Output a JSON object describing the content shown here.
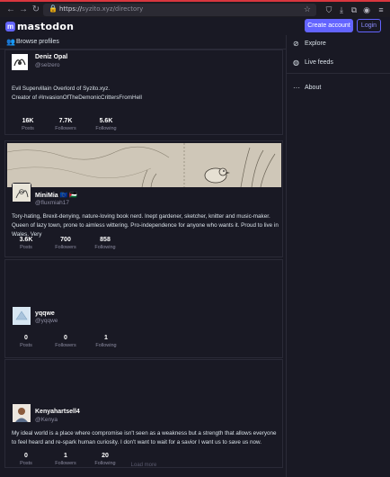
{
  "browser": {
    "url_domain": "sy",
    "url_rest": "zito.xyz",
    "url_path": "/directory",
    "back_icon": "arrow-left-icon",
    "forward_icon": "arrow-right-icon",
    "reload_icon": "reload-icon"
  },
  "header": {
    "logo_text": "mastodon",
    "create_account_label": "Create account",
    "login_label": "Login"
  },
  "main": {
    "title": "Browse profiles",
    "load_more_label": "Load more",
    "profiles": [
      {
        "name": "Deniz Opal",
        "handle": "@selzero",
        "bio": "Evil Supervillain Overlord of Syzito.xyz.\nCreator of #InvasionOfTheDemonicCrittersFromHell",
        "stats": [
          {
            "value": "16K",
            "label": "Posts"
          },
          {
            "value": "7.7K",
            "label": "Followers"
          },
          {
            "value": "5.6K",
            "label": "Following"
          }
        ]
      },
      {
        "name": "MiniMia 🇪🇺 🇵🇸",
        "handle": "@fluxmiah17",
        "bio": "Tory-hating, Brexit-denying, nature-loving book nerd. Inept gardener, sketcher, knitter and music-maker. Queen of lazy town, prone to aimless wittering. Pro-independence for anyone who wants it. Proud to live in Wales. Very",
        "stats": [
          {
            "value": "3.6K",
            "label": "Posts"
          },
          {
            "value": "700",
            "label": "Followers"
          },
          {
            "value": "858",
            "label": "Following"
          }
        ]
      },
      {
        "name": "yqqwe",
        "handle": "@yqqwe",
        "bio": "",
        "stats": [
          {
            "value": "0",
            "label": "Posts"
          },
          {
            "value": "0",
            "label": "Followers"
          },
          {
            "value": "1",
            "label": "Following"
          }
        ]
      },
      {
        "name": "Kenyahartsell4",
        "handle": "@Kenya",
        "bio": "My ideal world is a place where compromise isn't seen as a weakness but a strength that allows everyone to feel heard and re-spark human curiosity. I don't want to wait for a savior I want us to save us now.",
        "stats": [
          {
            "value": "0",
            "label": "Posts"
          },
          {
            "value": "1",
            "label": "Followers"
          },
          {
            "value": "20",
            "label": "Following"
          }
        ]
      }
    ]
  },
  "sidebar": {
    "items": [
      {
        "label": "Explore",
        "icon": "compass-icon"
      },
      {
        "label": "Live feeds",
        "icon": "globe-icon"
      },
      {
        "label": "About",
        "icon": "ellipsis-icon"
      }
    ]
  },
  "colors": {
    "accent": "#6364ff",
    "background": "#191924"
  }
}
